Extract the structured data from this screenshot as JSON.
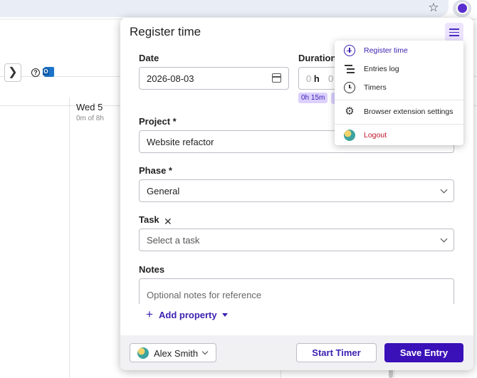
{
  "browser": {
    "star_icon": "star-icon",
    "extension_icon": "extension-icon"
  },
  "background": {
    "day_label": "Wed 5",
    "day_hours": "0m of 8h",
    "nav_next": "❯",
    "help": "?",
    "outlook": "O"
  },
  "panel": {
    "title": "Register time",
    "date": {
      "label": "Date",
      "value": "2026-08-03"
    },
    "duration": {
      "label": "Duration",
      "hours_value": "0",
      "hours_unit": "h",
      "minutes_value": "0",
      "chip": "0h 15m"
    },
    "project": {
      "label": "Project *",
      "value": "Website refactor"
    },
    "phase": {
      "label": "Phase *",
      "value": "General"
    },
    "task": {
      "label": "Task",
      "clear": "✕",
      "placeholder": "Select a task"
    },
    "notes": {
      "label": "Notes",
      "placeholder": "Optional notes for reference"
    },
    "add_property": {
      "plus": "+",
      "label": "Add property"
    }
  },
  "footer": {
    "user_name": "Alex Smith",
    "start_label": "Start Timer",
    "save_label": "Save Entry"
  },
  "menu": {
    "items": [
      {
        "label": "Register time",
        "icon": "plus-circle-icon",
        "color": "#3b1fb0"
      },
      {
        "label": "Entries log",
        "icon": "list-icon",
        "color": "#222222"
      },
      {
        "label": "Timers",
        "icon": "clock-icon",
        "color": "#222222"
      },
      {
        "label": "Browser extension settings",
        "icon": "gear-icon",
        "color": "#222222"
      },
      {
        "label": "Logout",
        "icon": "avatar-icon",
        "color": "#c0172a"
      }
    ]
  },
  "colors": {
    "accent": "#3a10b8",
    "chip_bg": "#dcd0ff",
    "logout": "#c0172a"
  }
}
